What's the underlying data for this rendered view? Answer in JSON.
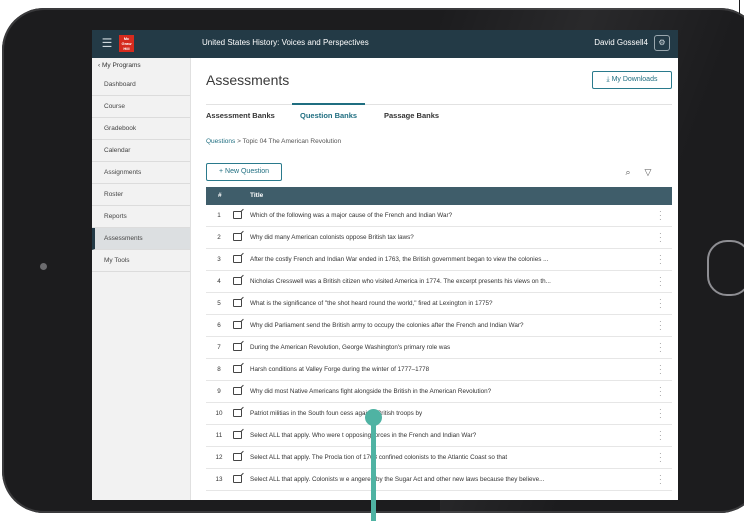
{
  "topbar": {
    "app_title": "United States History: Voices and Perspectives",
    "user_name": "David Gossell4",
    "logo_text": "Mc Graw Hill"
  },
  "sidebar": {
    "back_label": "My Programs",
    "items": [
      {
        "label": "Dashboard"
      },
      {
        "label": "Course"
      },
      {
        "label": "Gradebook"
      },
      {
        "label": "Calendar"
      },
      {
        "label": "Assignments"
      },
      {
        "label": "Roster"
      },
      {
        "label": "Reports"
      },
      {
        "label": "Assessments"
      },
      {
        "label": "My Tools"
      }
    ],
    "active_item": "Assessments"
  },
  "main": {
    "title": "Assessments",
    "downloads_label": "My Downloads",
    "tabs": [
      {
        "label": "Assessment Banks"
      },
      {
        "label": "Question Banks"
      },
      {
        "label": "Passage Banks"
      }
    ],
    "active_tab": "Question Banks",
    "breadcrumb": {
      "link": "Questions",
      "separator": ">",
      "current": "Topic 04 The American Revolution"
    },
    "new_question_label": "+ New Question",
    "table": {
      "headers": {
        "num": "#",
        "title": "Title"
      },
      "rows": [
        {
          "num": "1",
          "title": "Which of the following was a major cause of the French and Indian War?"
        },
        {
          "num": "2",
          "title": "Why did many American colonists oppose British tax laws?"
        },
        {
          "num": "3",
          "title": "After the costly French and Indian War ended in 1763, the British government began to view the colonies ..."
        },
        {
          "num": "4",
          "title": "Nicholas Cresswell was a British citizen who visited America in 1774. The excerpt presents his views on th..."
        },
        {
          "num": "5",
          "title": "What is the significance of \"the shot heard round the world,\" fired at Lexington in 1775?"
        },
        {
          "num": "6",
          "title": "Why did Parliament send the British army to occupy the colonies after the French and Indian War?"
        },
        {
          "num": "7",
          "title": "During the American Revolution, George Washington's primary role was"
        },
        {
          "num": "8",
          "title": "Harsh conditions at Valley Forge during the winter of 1777–1778"
        },
        {
          "num": "9",
          "title": "Why did most Native Americans fight alongside the British in the American Revolution?"
        },
        {
          "num": "10",
          "title": "Patriot militias in the South foun     cess against British troops by"
        },
        {
          "num": "11",
          "title": "Select ALL that apply. Who were t   opposing forces in the French and Indian War?"
        },
        {
          "num": "12",
          "title": "Select ALL that apply. The Procla   tion of 1763 confined colonists to the Atlantic Coast so that"
        },
        {
          "num": "13",
          "title": "Select ALL that apply. Colonists w   e angered by the Sugar Act and other new laws because they believe..."
        }
      ]
    }
  },
  "colors": {
    "topbar": "#233a46",
    "accent": "#1f6e80",
    "table_header": "#3f5d6a",
    "pointer": "#4fb3a3",
    "logo": "#d52b1e"
  }
}
